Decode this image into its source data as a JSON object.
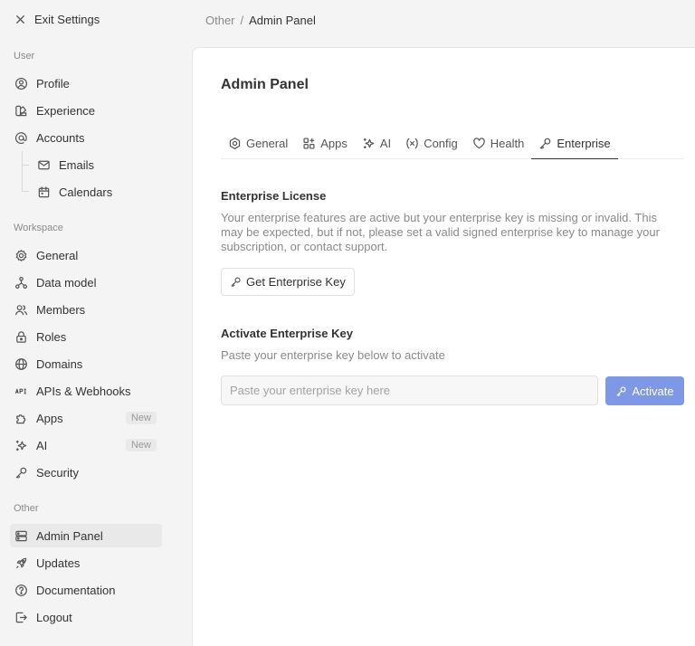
{
  "sidebar": {
    "exit_label": "Exit Settings",
    "sections": {
      "user": "User",
      "workspace": "Workspace",
      "other": "Other"
    },
    "user_items": {
      "profile": "Profile",
      "experience": "Experience",
      "accounts": "Accounts",
      "emails": "Emails",
      "calendars": "Calendars"
    },
    "workspace_items": {
      "general": "General",
      "data_model": "Data model",
      "members": "Members",
      "roles": "Roles",
      "domains": "Domains",
      "apis": "APIs & Webhooks",
      "apps": "Apps",
      "apps_badge": "New",
      "ai": "AI",
      "ai_badge": "New",
      "security": "Security"
    },
    "other_items": {
      "admin_panel": "Admin Panel",
      "updates": "Updates",
      "documentation": "Documentation",
      "logout": "Logout"
    },
    "active_item": "Admin Panel"
  },
  "breadcrumb": {
    "parent": "Other",
    "separator": "/",
    "current": "Admin Panel"
  },
  "main": {
    "title": "Admin Panel",
    "tabs": {
      "general": "General",
      "apps": "Apps",
      "ai": "AI",
      "config": "Config",
      "health": "Health",
      "enterprise": "Enterprise"
    },
    "active_tab": "Enterprise",
    "license": {
      "heading": "Enterprise License",
      "description": "Your enterprise features are active but your enterprise key is missing or invalid. This may be expected, but if not, please set a valid signed enterprise key to manage your subscription, or contact support.",
      "get_key_label": "Get Enterprise Key"
    },
    "activate": {
      "heading": "Activate Enterprise Key",
      "description": "Paste your enterprise key below to activate",
      "input_value": "",
      "input_placeholder": "Paste your enterprise key here",
      "button_label": "Activate"
    }
  },
  "colors": {
    "sidebar_bg": "#f4f4f4",
    "main_bg": "#ffffff",
    "active_item_bg": "#e9e9e9",
    "activate_button": "#7f98e6"
  }
}
